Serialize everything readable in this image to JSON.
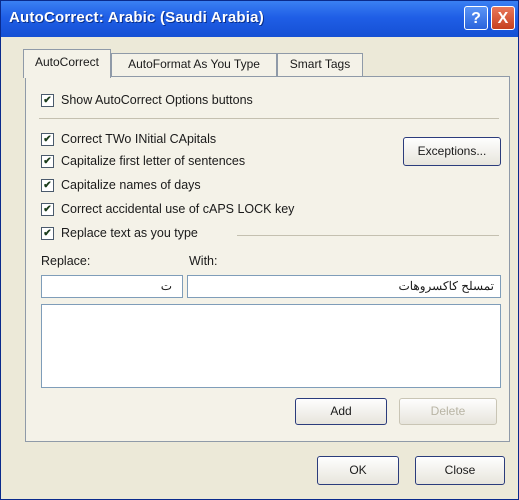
{
  "window": {
    "title": "AutoCorrect: Arabic (Saudi Arabia)"
  },
  "title_buttons": {
    "help": "?",
    "close": "X"
  },
  "tabs": [
    {
      "label": "AutoCorrect"
    },
    {
      "label": "AutoFormat As You Type"
    },
    {
      "label": "Smart Tags"
    }
  ],
  "options": {
    "show_options_buttons": "Show AutoCorrect Options buttons",
    "two_initial_caps": "Correct TWo INitial CApitals",
    "capitalize_sentences": "Capitalize first letter of sentences",
    "capitalize_days": "Capitalize names of days",
    "caps_lock": "Correct accidental use of cAPS LOCK key",
    "replace_as_you_type": "Replace text as you type"
  },
  "exceptions_label": "Exceptions...",
  "replace": {
    "label": "Replace:",
    "value": "ت"
  },
  "with": {
    "label": "With:",
    "value": "تمسلح كاكسروهات"
  },
  "buttons": {
    "add": "Add",
    "delete": "Delete",
    "ok": "OK",
    "close": "Close"
  },
  "checkbox_mark": "✔"
}
